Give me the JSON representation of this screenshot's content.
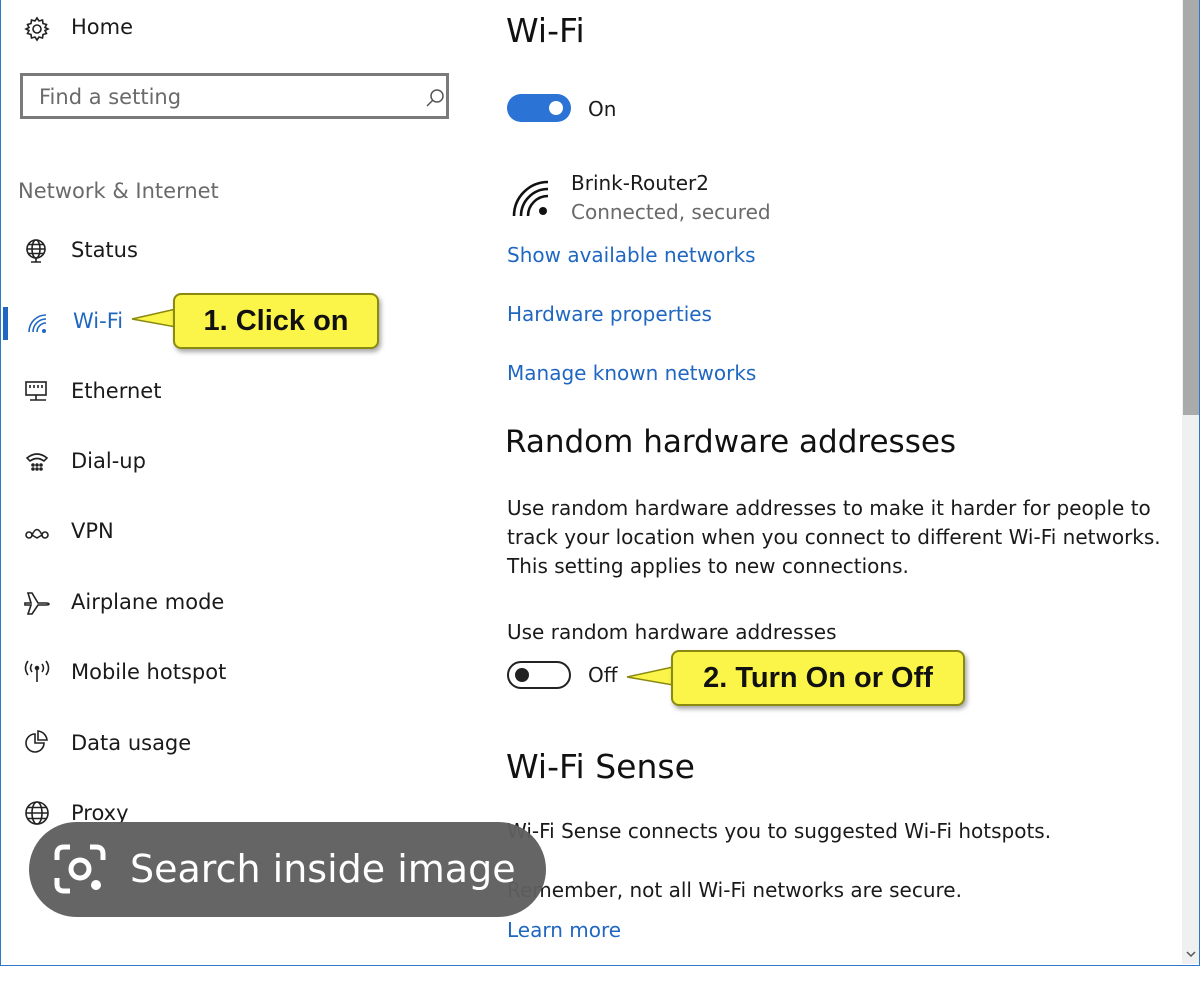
{
  "sidebar": {
    "home_label": "Home",
    "search_placeholder": "Find a setting",
    "section_heading": "Network & Internet",
    "items": [
      {
        "label": "Status"
      },
      {
        "label": "Wi-Fi"
      },
      {
        "label": "Ethernet"
      },
      {
        "label": "Dial-up"
      },
      {
        "label": "VPN"
      },
      {
        "label": "Airplane mode"
      },
      {
        "label": "Mobile hotspot"
      },
      {
        "label": "Data usage"
      },
      {
        "label": "Proxy"
      }
    ]
  },
  "main": {
    "title": "Wi-Fi",
    "wifi_toggle": {
      "state": "On",
      "on": true
    },
    "network": {
      "name": "Brink-Router2",
      "status": "Connected, secured"
    },
    "links": {
      "show_networks": "Show available networks",
      "hardware_properties": "Hardware properties",
      "manage_known": "Manage known networks"
    },
    "random_section": {
      "heading": "Random hardware addresses",
      "description": "Use random hardware addresses to make it harder for people to track your location when you connect to different Wi-Fi networks. This setting applies to new connections.",
      "toggle_label": "Use random hardware addresses",
      "toggle_state": "Off",
      "on": false
    },
    "sense_section": {
      "heading": "Wi-Fi Sense",
      "line1": "Wi-Fi Sense connects you to suggested Wi-Fi hotspots.",
      "line2": "Remember, not all Wi-Fi networks are secure.",
      "learn_more": "Learn more"
    }
  },
  "callouts": {
    "step1": "1. Click on",
    "step2": "2. Turn On or Off"
  },
  "overlay": {
    "lens_label": "Search inside image"
  },
  "colors": {
    "accent": "#1f67c1",
    "toggle_on": "#2b73d4",
    "callout_fill": "#fbf54a",
    "overlay_pill": "#5f5f5f"
  }
}
